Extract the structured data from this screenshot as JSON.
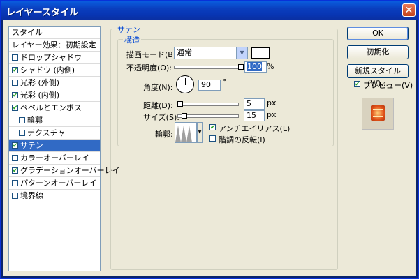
{
  "window": {
    "title": "レイヤースタイル",
    "close_glyph": "✕"
  },
  "style_list": {
    "header": "スタイル",
    "blend_options": "レイヤー効果：初期設定",
    "items": [
      {
        "label": "ドロップシャドウ",
        "checked": false
      },
      {
        "label": "シャドウ (内側)",
        "checked": true
      },
      {
        "label": "光彩 (外側)",
        "checked": false
      },
      {
        "label": "光彩 (内側)",
        "checked": true
      },
      {
        "label": "ベベルとエンボス",
        "checked": true
      },
      {
        "label": "輪郭",
        "checked": false
      },
      {
        "label": "テクスチャ",
        "checked": false
      },
      {
        "label": "サテン",
        "checked": true,
        "selected": true
      },
      {
        "label": "カラーオーバーレイ",
        "checked": false
      },
      {
        "label": "グラデーションオーバーレイ",
        "checked": true
      },
      {
        "label": "パターンオーバーレイ",
        "checked": false
      },
      {
        "label": "境界線",
        "checked": false
      }
    ]
  },
  "satin": {
    "group_title": "サテン",
    "structure_title": "構造",
    "blend_mode_label": "描画モード(B):",
    "blend_mode_value": "通常",
    "blend_color": "#ffffff",
    "opacity_label": "不透明度(O):",
    "opacity_value": "100",
    "opacity_unit": "%",
    "angle_label": "角度(N):",
    "angle_value": "90",
    "angle_unit": "°",
    "distance_label": "距離(D):",
    "distance_value": "5",
    "distance_unit": "px",
    "size_label": "サイズ(S):",
    "size_value": "15",
    "size_unit": "px",
    "contour_label": "輪郭:",
    "antialias_label": "アンチエイリアス(L)",
    "antialias_checked": true,
    "invert_label": "階調の反転(I)",
    "invert_checked": false
  },
  "buttons": {
    "ok": "OK",
    "reset": "初期化",
    "new_style": "新規スタイル(W)...",
    "preview_label": "プレビュー(V)",
    "preview_checked": true
  },
  "colors": {
    "selection": "#316ac5",
    "title_bar": "#0a3fbf",
    "group_title": "#0046d5"
  }
}
